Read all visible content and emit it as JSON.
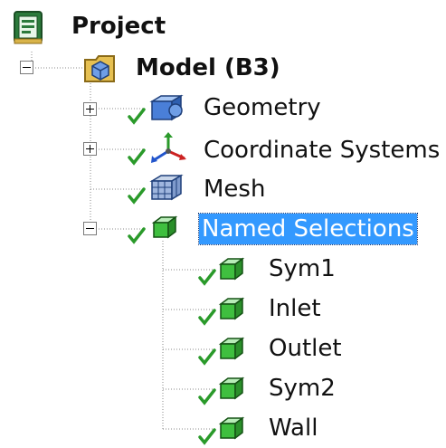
{
  "tree": {
    "root": {
      "label": "Project",
      "icon": "project-icon"
    },
    "model": {
      "label": "Model (B3)",
      "icon": "model-icon",
      "expanded": true
    },
    "items": [
      {
        "label": "Geometry",
        "icon": "geometry-icon",
        "expander": "plus",
        "status": "check"
      },
      {
        "label": "Coordinate Systems",
        "icon": "coordinate-systems-icon",
        "expander": "plus",
        "status": "check"
      },
      {
        "label": "Mesh",
        "icon": "mesh-icon",
        "expander": "none",
        "status": "check"
      },
      {
        "label": "Named Selections",
        "icon": "named-selections-icon",
        "expander": "minus",
        "status": "check",
        "selected": true
      }
    ],
    "named_selections": [
      {
        "label": "Sym1",
        "icon": "selection-icon",
        "status": "check"
      },
      {
        "label": "Inlet",
        "icon": "selection-icon",
        "status": "check"
      },
      {
        "label": "Outlet",
        "icon": "selection-icon",
        "status": "check"
      },
      {
        "label": "Sym2",
        "icon": "selection-icon",
        "status": "check"
      },
      {
        "label": "Wall",
        "icon": "selection-icon",
        "status": "check"
      }
    ]
  },
  "colors": {
    "selection_bg": "#3399ff",
    "check": "#2a9a2a",
    "solid_green": "#3fbf3f",
    "solid_blue": "#4a7fd8",
    "tree_line": "#8a8a8a"
  }
}
